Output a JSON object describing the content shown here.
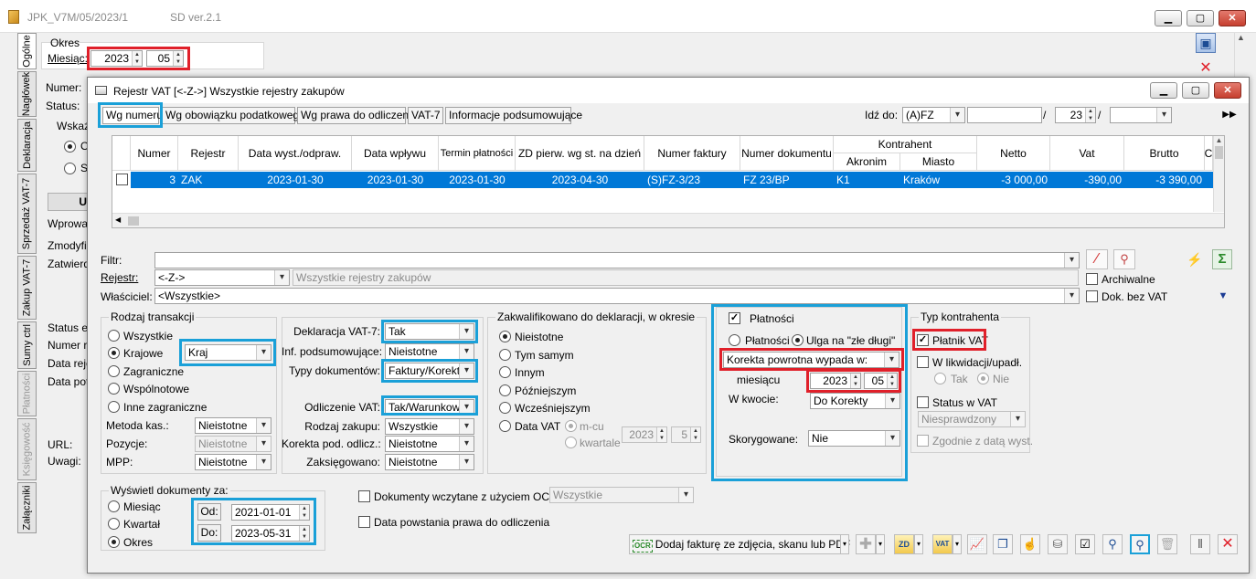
{
  "outer": {
    "title": "JPK_V7M/05/2023/1",
    "version": "SD ver.2.1",
    "okres_label": "Okres",
    "miesiac_label": "Miesiąc:",
    "year": "2023",
    "month": "05",
    "numer_label": "Numer:",
    "status_label": "Status:",
    "wskaz_label": "Wskaź",
    "radio1": "O",
    "radio2": "S",
    "button_cut": "U",
    "wprowa_label": "Wprowa",
    "zmodyfi_label": "Zmodyfik",
    "zatwierd_label": "Zatwierd",
    "status_e_label": "Status e",
    "numer_rej_label": "Numer re",
    "data_rej_label": "Data reje",
    "data_pot_label": "Data pot",
    "url_label": "URL:",
    "uwagi_label": "Uwagi:"
  },
  "vertical_tabs": [
    "Ogólne",
    "Nagłówek",
    "Deklaracja",
    "Sprzedaż VAT-7",
    "Zakup VAT-7",
    "Sumy ctrl",
    "Płatności",
    "Księgowość",
    "Załączniki"
  ],
  "inner": {
    "title": "Rejestr VAT  [<-Z->]  Wszystkie rejestry zakupów",
    "tabs": [
      "Wg numeru",
      "Wg obowiązku podatkowego",
      "Wg prawa do odliczenia",
      "VAT-7",
      "Informacje podsumowujące"
    ],
    "idz_do_label": "Idź do:",
    "idz_do_value": "(A)FZ",
    "idz_do_num": "23",
    "slash": "/"
  },
  "grid": {
    "headers": [
      "Numer",
      "Rejestr",
      "Data wyst./odpraw.",
      "Data wpływu",
      "Termin płatności",
      "ZD pierw. wg st. na dzień",
      "Numer faktury",
      "Numer dokumentu",
      "Kontrahent",
      "Akronim",
      "Miasto",
      "Netto",
      "Vat",
      "Brutto",
      "C"
    ],
    "row": {
      "numer": "3",
      "rejestr": "ZAK",
      "data_wyst": "2023-01-30",
      "data_wplywu": "2023-01-30",
      "termin": "2023-01-30",
      "zd": "2023-04-30",
      "nr_faktury": "(S)FZ-3/23",
      "nr_dokumentu": "FZ 23/BP",
      "akronim": "K1",
      "miasto": "Kraków",
      "netto": "-3 000,00",
      "vat": "-390,00",
      "brutto": "-3 390,00"
    }
  },
  "filters": {
    "filtr_label": "Filtr:",
    "rejestr_label": "Rejestr:",
    "rejestr_value": "<-Z->",
    "rejestr_desc": "Wszystkie rejestry zakupów",
    "wlasciciel_label": "Właściciel:",
    "wlasciciel_value": "<Wszystkie>",
    "archiwalne": "Archiwalne",
    "dok_bez_vat": "Dok. bez VAT"
  },
  "rodzaj": {
    "title": "Rodzaj transakcji",
    "wszystkie": "Wszystkie",
    "krajowe": "Krajowe",
    "krajowe_value": "Kraj",
    "zagraniczne": "Zagraniczne",
    "wspolnotowe": "Wspólnotowe",
    "inne": "Inne zagraniczne",
    "metoda_label": "Metoda kas.:",
    "metoda_value": "Nieistotne",
    "pozycje_label": "Pozycje:",
    "pozycje_value": "Nieistotne",
    "mpp_label": "MPP:",
    "mpp_value": "Nieistotne"
  },
  "deklaracja": {
    "vat7_label": "Deklaracja VAT-7:",
    "vat7_value": "Tak",
    "inf_label": "Inf. podsumowujące:",
    "inf_value": "Nieistotne",
    "typy_label": "Typy dokumentów:",
    "typy_value": "Faktury/Korekty",
    "odliczenie_label": "Odliczenie VAT:",
    "odliczenie_value": "Tak/Warunkowo",
    "rodzaj_zakupu_label": "Rodzaj zakupu:",
    "rodzaj_zakupu_value": "Wszystkie",
    "korekta_label": "Korekta pod. odlicz.:",
    "korekta_value": "Nieistotne",
    "zaksiegowano_label": "Zaksięgowano:",
    "zaksiegowano_value": "Nieistotne"
  },
  "zakwalifikowano": {
    "title": "Zakwalifikowano do deklaracji, w okresie",
    "options": [
      "Nieistotne",
      "Tym samym",
      "Innym",
      "Późniejszym",
      "Wcześniejszym",
      "Data VAT"
    ],
    "mcu": "m-cu",
    "kwartale": "kwartale",
    "year": "2023",
    "num": "5"
  },
  "platnosci": {
    "title": "Płatności",
    "opt_platnosci": "Płatności",
    "opt_ulga": "Ulga na \"złe długi\"",
    "korekta_value": "Korekta powrotna wypada w:",
    "miesiacu_label": "miesiącu",
    "year": "2023",
    "month": "05",
    "w_kwocie_label": "W kwocie:",
    "w_kwocie_value": "Do Korekty",
    "skorygowane_label": "Skorygowane:",
    "skorygowane_value": "Nie"
  },
  "typ_kontrahenta": {
    "title": "Typ kontrahenta",
    "platnik": "Płatnik VAT",
    "likwidacji": "W likwidacji/upadł.",
    "tak": "Tak",
    "nie": "Nie",
    "status": "Status w VAT",
    "status_value": "Niesprawdzony",
    "zgodnie": "Zgodnie z datą wyst."
  },
  "wyswietl": {
    "title": "Wyświetl dokumenty za:",
    "miesiac": "Miesiąc",
    "kwartal": "Kwartał",
    "okres": "Okres",
    "od_label": "Od:",
    "od_value": "2021-01-01",
    "do_label": "Do:",
    "do_value": "2023-05-31"
  },
  "bottom": {
    "ocr_label": "Dokumenty wczytane z użyciem OCR",
    "ocr_value": "Wszystkie",
    "data_powstania": "Data powstania prawa do odliczenia",
    "ocr_button": "Dodaj fakturę ze zdjęcia, skanu lub PDF",
    "ocr_badge": "OCR"
  },
  "colors": {
    "selection": "#0078d7",
    "highlight_red": "#e0202a",
    "highlight_blue": "#1aa0d8"
  }
}
